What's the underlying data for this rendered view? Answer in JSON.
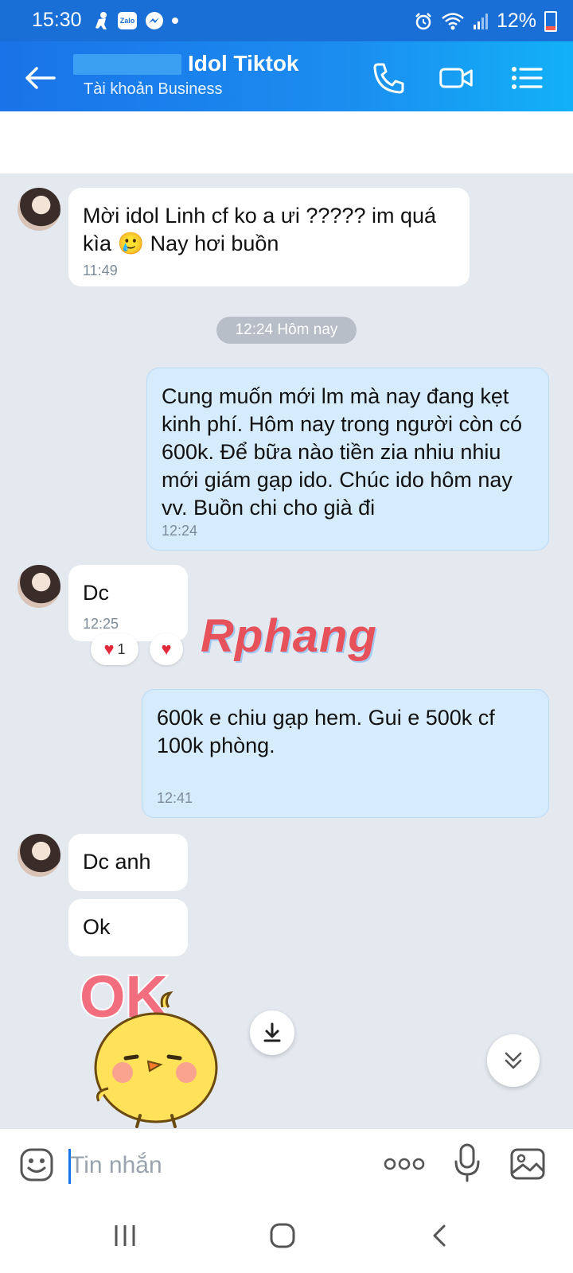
{
  "status_bar": {
    "time": "15:30",
    "battery": "12%",
    "app_icons": [
      "person-icon",
      "zalo-icon",
      "messenger-icon"
    ],
    "colors": {
      "bar": "#1a6fd6",
      "battery_low": "#ff5a4a"
    }
  },
  "header": {
    "contact_name": "Idol Tiktok",
    "subtitle": "Tài khoản Business",
    "icons": [
      "back-arrow-icon",
      "phone-icon",
      "video-call-icon",
      "menu-list-icon"
    ],
    "colors": {
      "gradient_start": "#1a73e8",
      "gradient_end": "#12b1f7"
    }
  },
  "messages": [
    {
      "direction": "incoming",
      "text": "Mời idol Linh cf ko a ưi ????? im quá kìa 🥲 Nay hơi buồn",
      "time": "11:49"
    },
    {
      "type": "date_separator",
      "text": "12:24 Hôm nay"
    },
    {
      "direction": "outgoing",
      "text": "Cung muốn mới lm mà nay đang kẹt kinh phí. Hôm nay trong người còn có 600k. Để bữa nào tiền zia nhiu nhiu mới giám gạp ido. Chúc ido hôm nay vv. Buồn chi cho già đi",
      "time": "12:24"
    },
    {
      "direction": "incoming",
      "text": "Dc",
      "time": "12:25",
      "reactions": {
        "summary_count": "1",
        "icon": "heart-icon"
      }
    },
    {
      "direction": "outgoing",
      "text": "600k e chiu gạp hem. Gui e 500k cf 100k phòng.",
      "time": "12:41"
    },
    {
      "direction": "incoming",
      "text": "Dc anh"
    },
    {
      "direction": "incoming",
      "text": "Ok"
    },
    {
      "direction": "incoming",
      "type": "sticker",
      "sticker": "ok-chick-sticker",
      "sticker_text": "OK"
    }
  ],
  "watermark": "Rphang",
  "input": {
    "placeholder": "Tin nhắn",
    "icons": [
      "emoji-icon",
      "more-dots-icon",
      "microphone-icon",
      "image-icon"
    ]
  },
  "nav": {
    "icons": [
      "recent-apps-icon",
      "home-icon",
      "back-icon"
    ]
  },
  "colors": {
    "chat_background": "#e4e8ef",
    "incoming_bubble": "#ffffff",
    "outgoing_bubble": "#d6ecfd",
    "heart": "#e3283a"
  }
}
